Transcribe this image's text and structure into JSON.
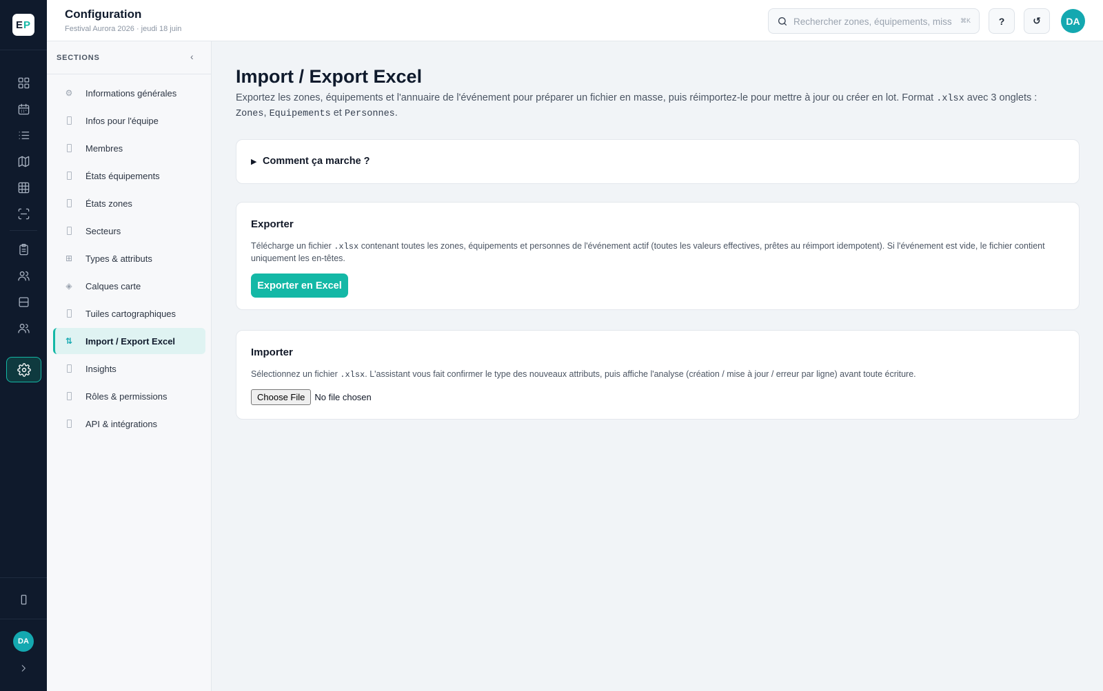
{
  "rail": {
    "logo": {
      "e": "E",
      "p": "P"
    },
    "icons": [
      "dashboard-icon",
      "calendar-icon",
      "list-icon",
      "map-icon",
      "grid-table-icon",
      "scan-icon",
      "clipboard-icon",
      "users-icon",
      "inbox-icon",
      "team-icon"
    ],
    "active_icon": "settings-gear-icon",
    "bottom_icon": "device-icon",
    "avatar": "DA",
    "expand_icon": "chevron-right-icon"
  },
  "topbar": {
    "title": "Configuration",
    "subtitle": "Festival Aurora 2026 · jeudi 18 juin",
    "search": {
      "placeholder": "Rechercher zones, équipements, missi",
      "shortcut": "⌘K"
    },
    "help_label": "?",
    "refresh_label": "↺",
    "avatar": "DA"
  },
  "sections": {
    "heading": "SECTIONS",
    "collapse_label": "‹",
    "items": [
      {
        "label": "Informations générales",
        "icon": "gear-icon"
      },
      {
        "label": "Infos pour l'équipe",
        "icon": "placeholder-icon"
      },
      {
        "label": "Membres",
        "icon": "placeholder-icon"
      },
      {
        "label": "États équipements",
        "icon": "placeholder-icon"
      },
      {
        "label": "États zones",
        "icon": "placeholder-icon"
      },
      {
        "label": "Secteurs",
        "icon": "placeholder-icon"
      },
      {
        "label": "Types & attributs",
        "icon": "grid-icon"
      },
      {
        "label": "Calques carte",
        "icon": "diamond-icon"
      },
      {
        "label": "Tuiles cartographiques",
        "icon": "placeholder-icon"
      },
      {
        "label": "Import / Export Excel",
        "icon": "swap-arrows-icon",
        "active": true
      },
      {
        "label": "Insights",
        "icon": "placeholder-icon"
      },
      {
        "label": "Rôles & permissions",
        "icon": "placeholder-icon"
      },
      {
        "label": "API & intégrations",
        "icon": "placeholder-icon"
      }
    ]
  },
  "main": {
    "title": "Import / Export Excel",
    "desc_1": "Exportez les zones, équipements et l'annuaire de l'événement pour préparer un fichier en masse, puis réimportez-le pour mettre à jour ou créer en lot. Format ",
    "desc_fmt": ".xlsx",
    "desc_2": " avec 3 onglets :",
    "desc_tab1": "Zones",
    "desc_sep1": ", ",
    "desc_tab2": "Equipements",
    "desc_sep2": " et ",
    "desc_tab3": "Personnes",
    "desc_end": ".",
    "how": {
      "toggle": "▶",
      "label": "Comment ça marche ?"
    },
    "export": {
      "title": "Exporter",
      "desc_1": "Télécharge un fichier ",
      "desc_fmt": ".xlsx",
      "desc_2": " contenant toutes les zones, équipements et personnes de l'événement actif (toutes les valeurs effectives, prêtes au réimport idempotent). Si l'événement est vide, le fichier contient uniquement les en-têtes.",
      "button": "Exporter en Excel"
    },
    "import": {
      "title": "Importer",
      "desc_1": "Sélectionnez un fichier ",
      "desc_fmt": ".xlsx",
      "desc_2": ". L'assistant vous fait confirmer le type des nouveaux attributs, puis affiche l'analyse (création / mise à jour / erreur par ligne) avant toute écriture.",
      "file_button": "Choose File",
      "file_status": "No file chosen"
    }
  },
  "colors": {
    "rail_bg": "#0f1a2c",
    "accent": "#14b8a6",
    "avatar": "#14a8b0",
    "page_bg": "#f1f4f7"
  }
}
